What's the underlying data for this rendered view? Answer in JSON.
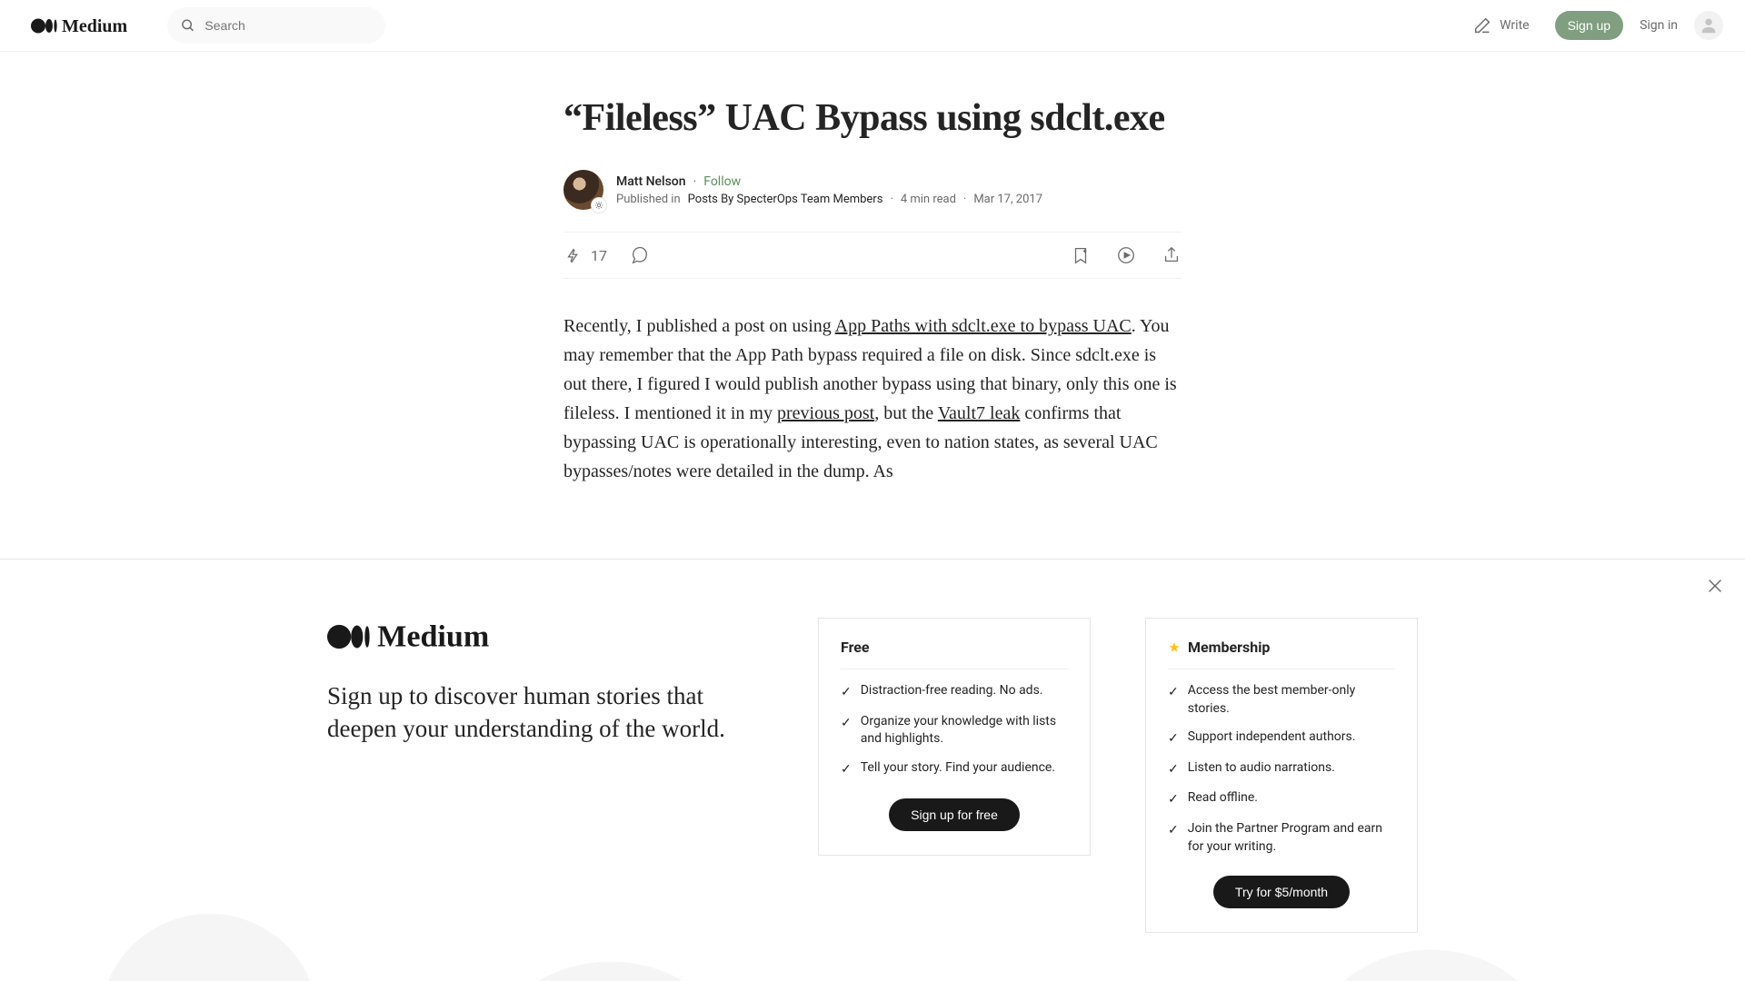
{
  "header": {
    "search_placeholder": "Search",
    "write_label": "Write",
    "signup_label": "Sign up",
    "signin_label": "Sign in"
  },
  "article": {
    "title": "“Fileless” UAC Bypass using sdclt.exe",
    "author": "Matt Nelson",
    "follow_label": "Follow",
    "published_in_prefix": "Published in",
    "publication": "Posts By SpecterOps Team Members",
    "read_time": "4 min read",
    "date": "Mar 17, 2017",
    "clap_count": "17",
    "body": {
      "p1_a": "Recently, I published a post on using ",
      "link1": "App Paths with sdclt.exe to bypass UAC",
      "p1_b": ". You may remember that the App Path bypass required a file on disk. Since sdclt.exe is out there, I figured I would publish another bypass using that binary, only this one is fileless. I mentioned it in my ",
      "link2": "previous post",
      "p1_c": ", but the ",
      "link3": "Vault7 leak",
      "p1_d": " confirms that bypassing UAC is operationally interesting, even to nation states, as several UAC bypasses/notes were detailed in the dump. As"
    }
  },
  "sheet": {
    "tagline": "Sign up to discover human stories that deepen your understanding of the world.",
    "free": {
      "title": "Free",
      "items": [
        "Distraction-free reading. No ads.",
        "Organize your knowledge with lists and highlights.",
        "Tell your story. Find your audience."
      ],
      "cta": "Sign up for free"
    },
    "member": {
      "title": "Membership",
      "items": [
        "Access the best member-only stories.",
        "Support independent authors.",
        "Listen to audio narrations.",
        "Read offline.",
        "Join the Partner Program and earn for your writing."
      ],
      "cta": "Try for $5/month"
    }
  }
}
